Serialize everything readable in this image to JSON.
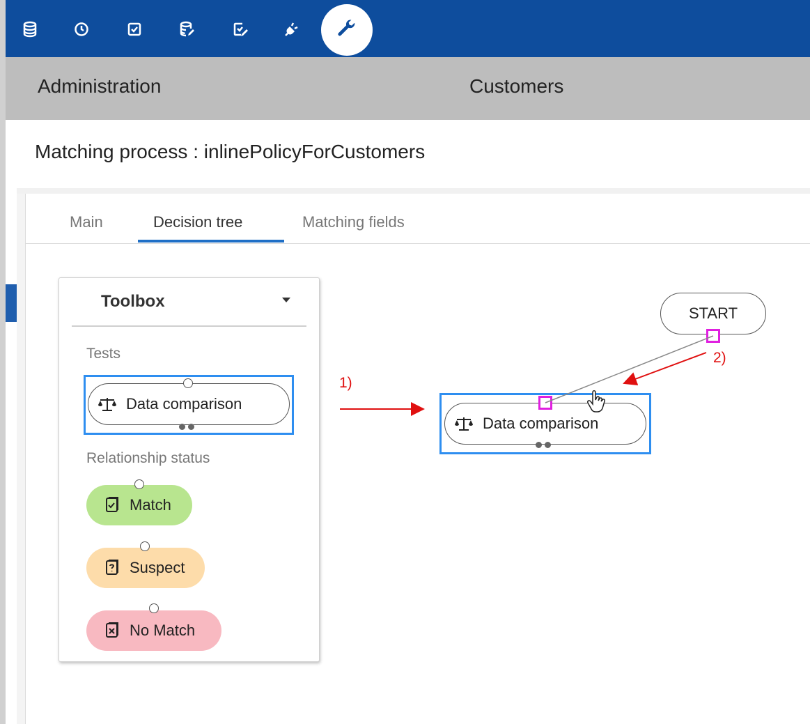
{
  "toolbar": {
    "icons": [
      "database-icon",
      "clock-icon",
      "checkbox-icon",
      "database-edit-icon",
      "checkbox-edit-icon",
      "plug-icon",
      "wrench-icon"
    ],
    "active_icon": "wrench-icon",
    "bar_color": "#0e4d9d"
  },
  "header": {
    "left_title": "Administration",
    "center_title": "Customers"
  },
  "page": {
    "title": "Matching process : inlinePolicyForCustomers"
  },
  "tabs": [
    {
      "label": "Main",
      "active": false
    },
    {
      "label": "Decision tree",
      "active": true
    },
    {
      "label": "Matching fields",
      "active": false
    }
  ],
  "toolbox": {
    "title": "Toolbox",
    "tests_label": "Tests",
    "test_item": {
      "label": "Data comparison",
      "icon": "scales-icon"
    },
    "status_label": "Relationship status",
    "statuses": [
      {
        "label": "Match",
        "icon": "match-icon",
        "color": "#b8e58f"
      },
      {
        "label": "Suspect",
        "icon": "suspect-icon",
        "color": "#fddcaa"
      },
      {
        "label": "No Match",
        "icon": "no-match-icon",
        "color": "#f8b9c1"
      }
    ]
  },
  "canvas": {
    "start_label": "START",
    "dropped_node": {
      "label": "Data comparison",
      "icon": "scales-icon"
    },
    "annotations": [
      "1)",
      "2)"
    ],
    "annotation_color": "#e01010",
    "selection_color": "#2e8ef0",
    "port_highlight_color": "#e020e0"
  }
}
